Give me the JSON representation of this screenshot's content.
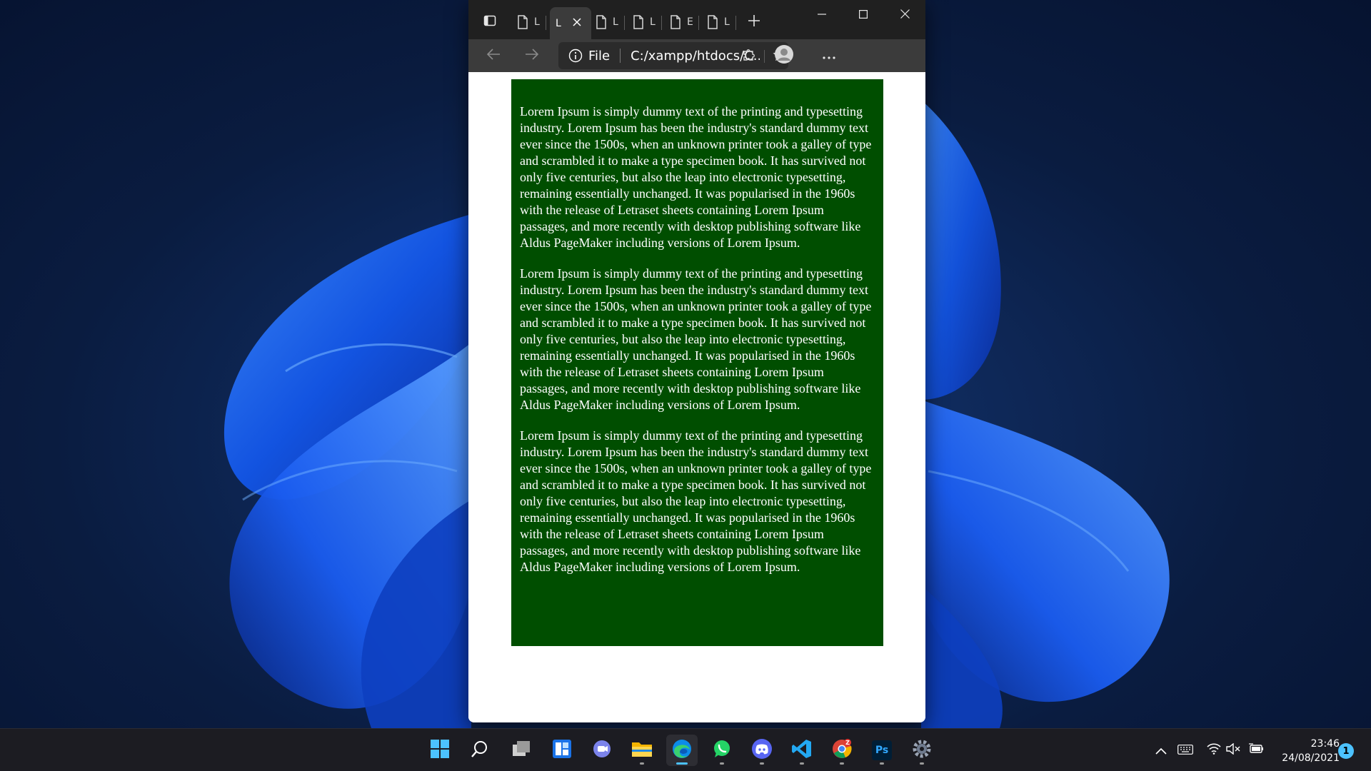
{
  "browser": {
    "tabs": [
      {
        "letter": "L",
        "icon": "page-icon"
      },
      {
        "letter": "L",
        "icon": "page-icon",
        "active": true
      },
      {
        "letter": "L",
        "icon": "page-icon"
      },
      {
        "letter": "L",
        "icon": "page-icon"
      },
      {
        "letter": "E",
        "icon": "page-icon"
      },
      {
        "letter": "L",
        "icon": "page-icon"
      }
    ],
    "window_controls": [
      "minimize-icon",
      "maximize-icon",
      "close-icon"
    ],
    "address": {
      "scheme_label": "File",
      "url": "C:/xampp/htdocs/C..."
    }
  },
  "page": {
    "box_color": "#004e00",
    "paragraphs": [
      "Lorem Ipsum is simply dummy text of the printing and typesetting industry. Lorem Ipsum has been the industry's standard dummy text ever since the 1500s, when an unknown printer took a galley of type and scrambled it to make a type specimen book. It has survived not only five centuries, but also the leap into electronic typesetting, remaining essentially unchanged. It was popularised in the 1960s with the release of Letraset sheets containing Lorem Ipsum passages, and more recently with desktop publishing software like Aldus PageMaker including versions of Lorem Ipsum.",
      "Lorem Ipsum is simply dummy text of the printing and typesetting industry. Lorem Ipsum has been the industry's standard dummy text ever since the 1500s, when an unknown printer took a galley of type and scrambled it to make a type specimen book. It has survived not only five centuries, but also the leap into electronic typesetting, remaining essentially unchanged. It was popularised in the 1960s with the release of Letraset sheets containing Lorem Ipsum passages, and more recently with desktop publishing software like Aldus PageMaker including versions of Lorem Ipsum.",
      "Lorem Ipsum is simply dummy text of the printing and typesetting industry. Lorem Ipsum has been the industry's standard dummy text ever since the 1500s, when an unknown printer took a galley of type and scrambled it to make a type specimen book. It has survived not only five centuries, but also the leap into electronic typesetting, remaining essentially unchanged. It was popularised in the 1960s with the release of Letraset sheets containing Lorem Ipsum passages, and more recently with desktop publishing software like Aldus PageMaker including versions of Lorem Ipsum."
    ]
  },
  "taskbar": {
    "apps": [
      {
        "name": "start-icon"
      },
      {
        "name": "search-icon"
      },
      {
        "name": "task-view-icon"
      },
      {
        "name": "widgets-icon"
      },
      {
        "name": "teams-chat-icon"
      },
      {
        "name": "file-explorer-icon",
        "running": true
      },
      {
        "name": "edge-icon",
        "running": true,
        "active": true
      },
      {
        "name": "whatsapp-icon",
        "running": true
      },
      {
        "name": "discord-icon",
        "running": true
      },
      {
        "name": "vscode-icon",
        "running": true
      },
      {
        "name": "chrome-icon",
        "running": true
      },
      {
        "name": "photoshop-icon",
        "label": "Ps",
        "running": true
      },
      {
        "name": "settings-icon",
        "running": true
      }
    ],
    "tray": [
      "chevron-up-icon",
      "keyboard-icon",
      "wifi-icon",
      "volume-muted-icon",
      "battery-icon"
    ],
    "time": "23:46",
    "date": "24/08/2021",
    "notification_count": "1",
    "accent": "#4cc2ff"
  }
}
